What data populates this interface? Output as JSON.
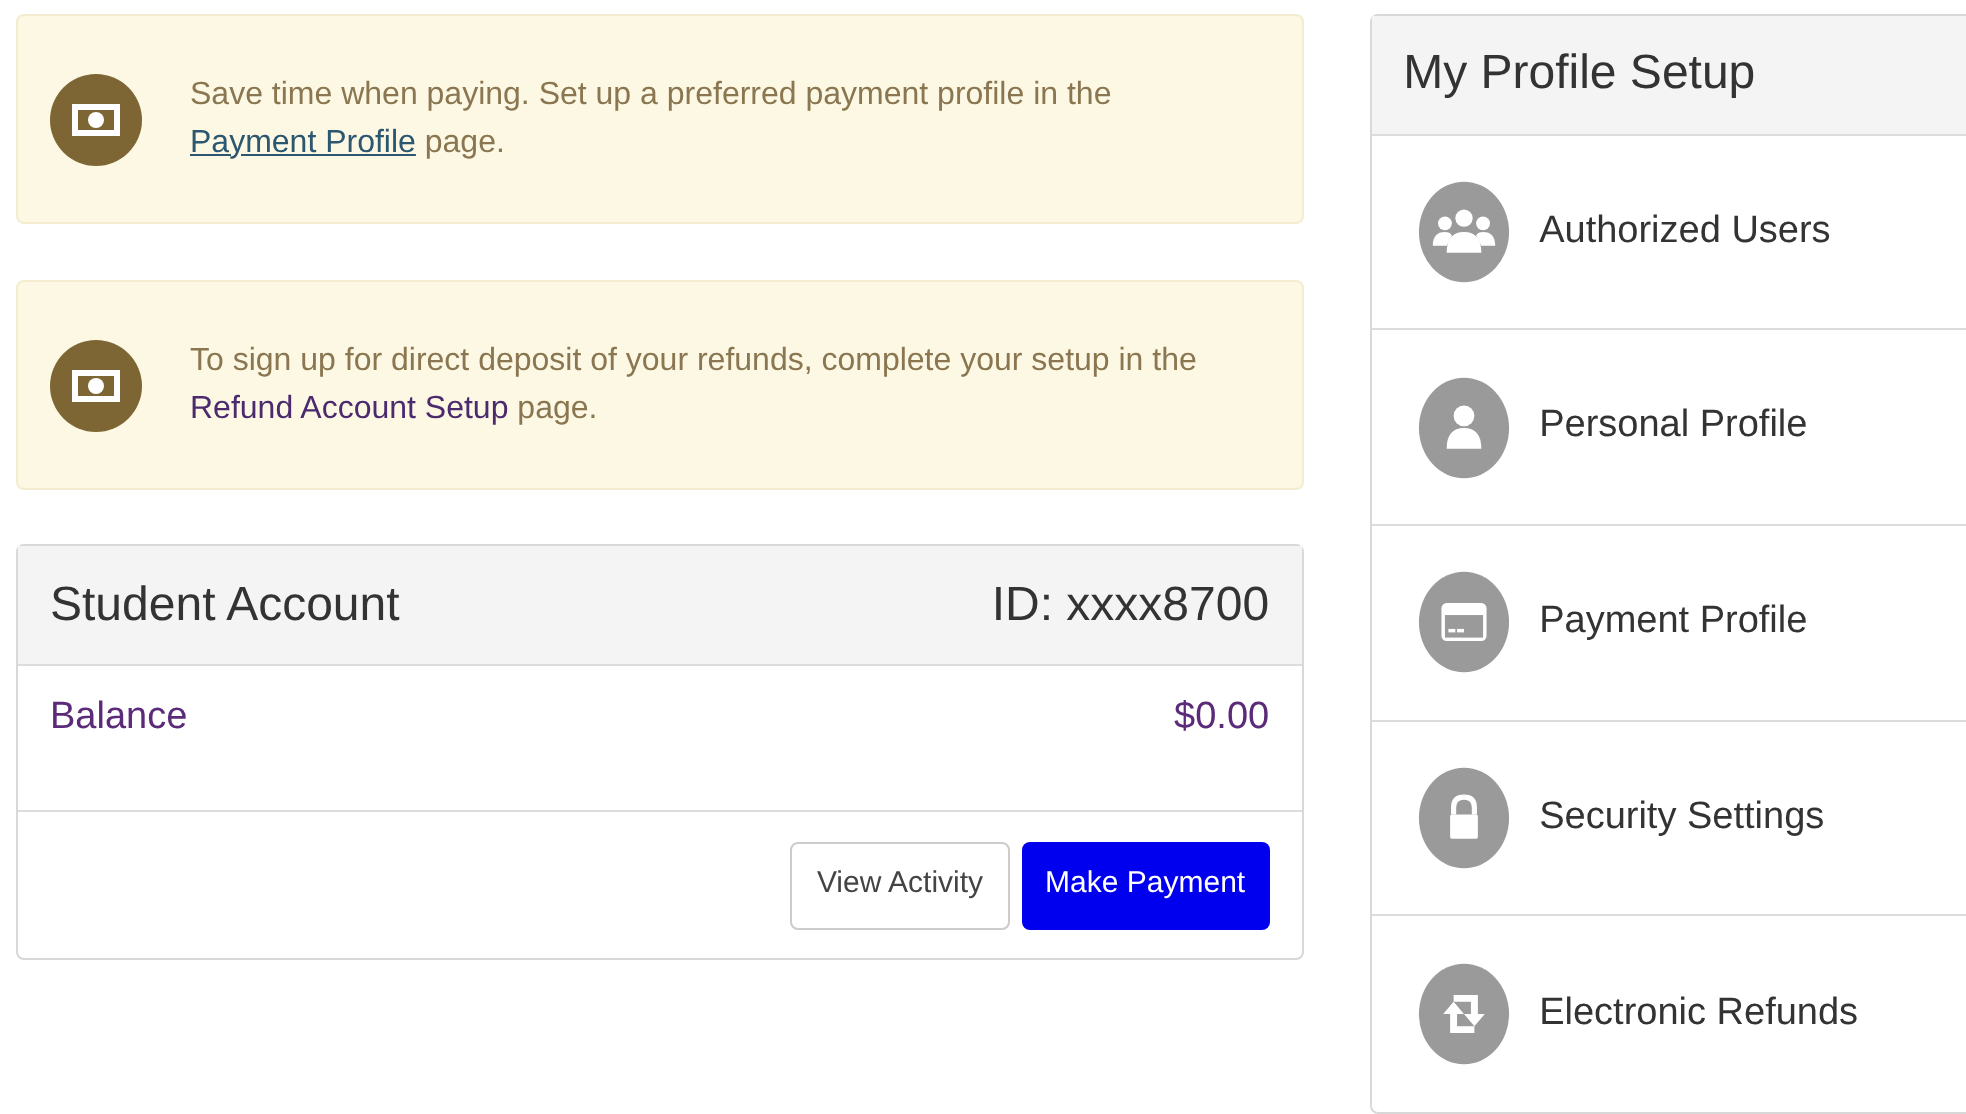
{
  "notices": [
    {
      "text_before": "Save time when paying. Set up a preferred payment profile in the ",
      "link": "Payment Profile",
      "text_after": " page.",
      "kind": "underlined"
    },
    {
      "text_before": "To sign up for direct deposit of your refunds, complete your setup in the ",
      "link": "Refund Account Setup",
      "text_after": " page.",
      "kind": "plain"
    }
  ],
  "account": {
    "title": "Student Account",
    "id": "ID: xxxx8700",
    "balance_label": "Balance",
    "balance_value": "$0.00",
    "buttons": [
      {
        "label": "View Activity",
        "kind": "secondary"
      },
      {
        "label": "Make Payment",
        "kind": "primary"
      }
    ]
  },
  "profile_setup": {
    "title": "My Profile Setup",
    "items": [
      {
        "label": "Authorized Users",
        "kind": "users"
      },
      {
        "label": "Personal Profile",
        "kind": "person"
      },
      {
        "label": "Payment Profile",
        "kind": "card"
      },
      {
        "label": "Security Settings",
        "kind": "lock"
      },
      {
        "label": "Electronic Refunds",
        "kind": "refresh"
      }
    ]
  }
}
